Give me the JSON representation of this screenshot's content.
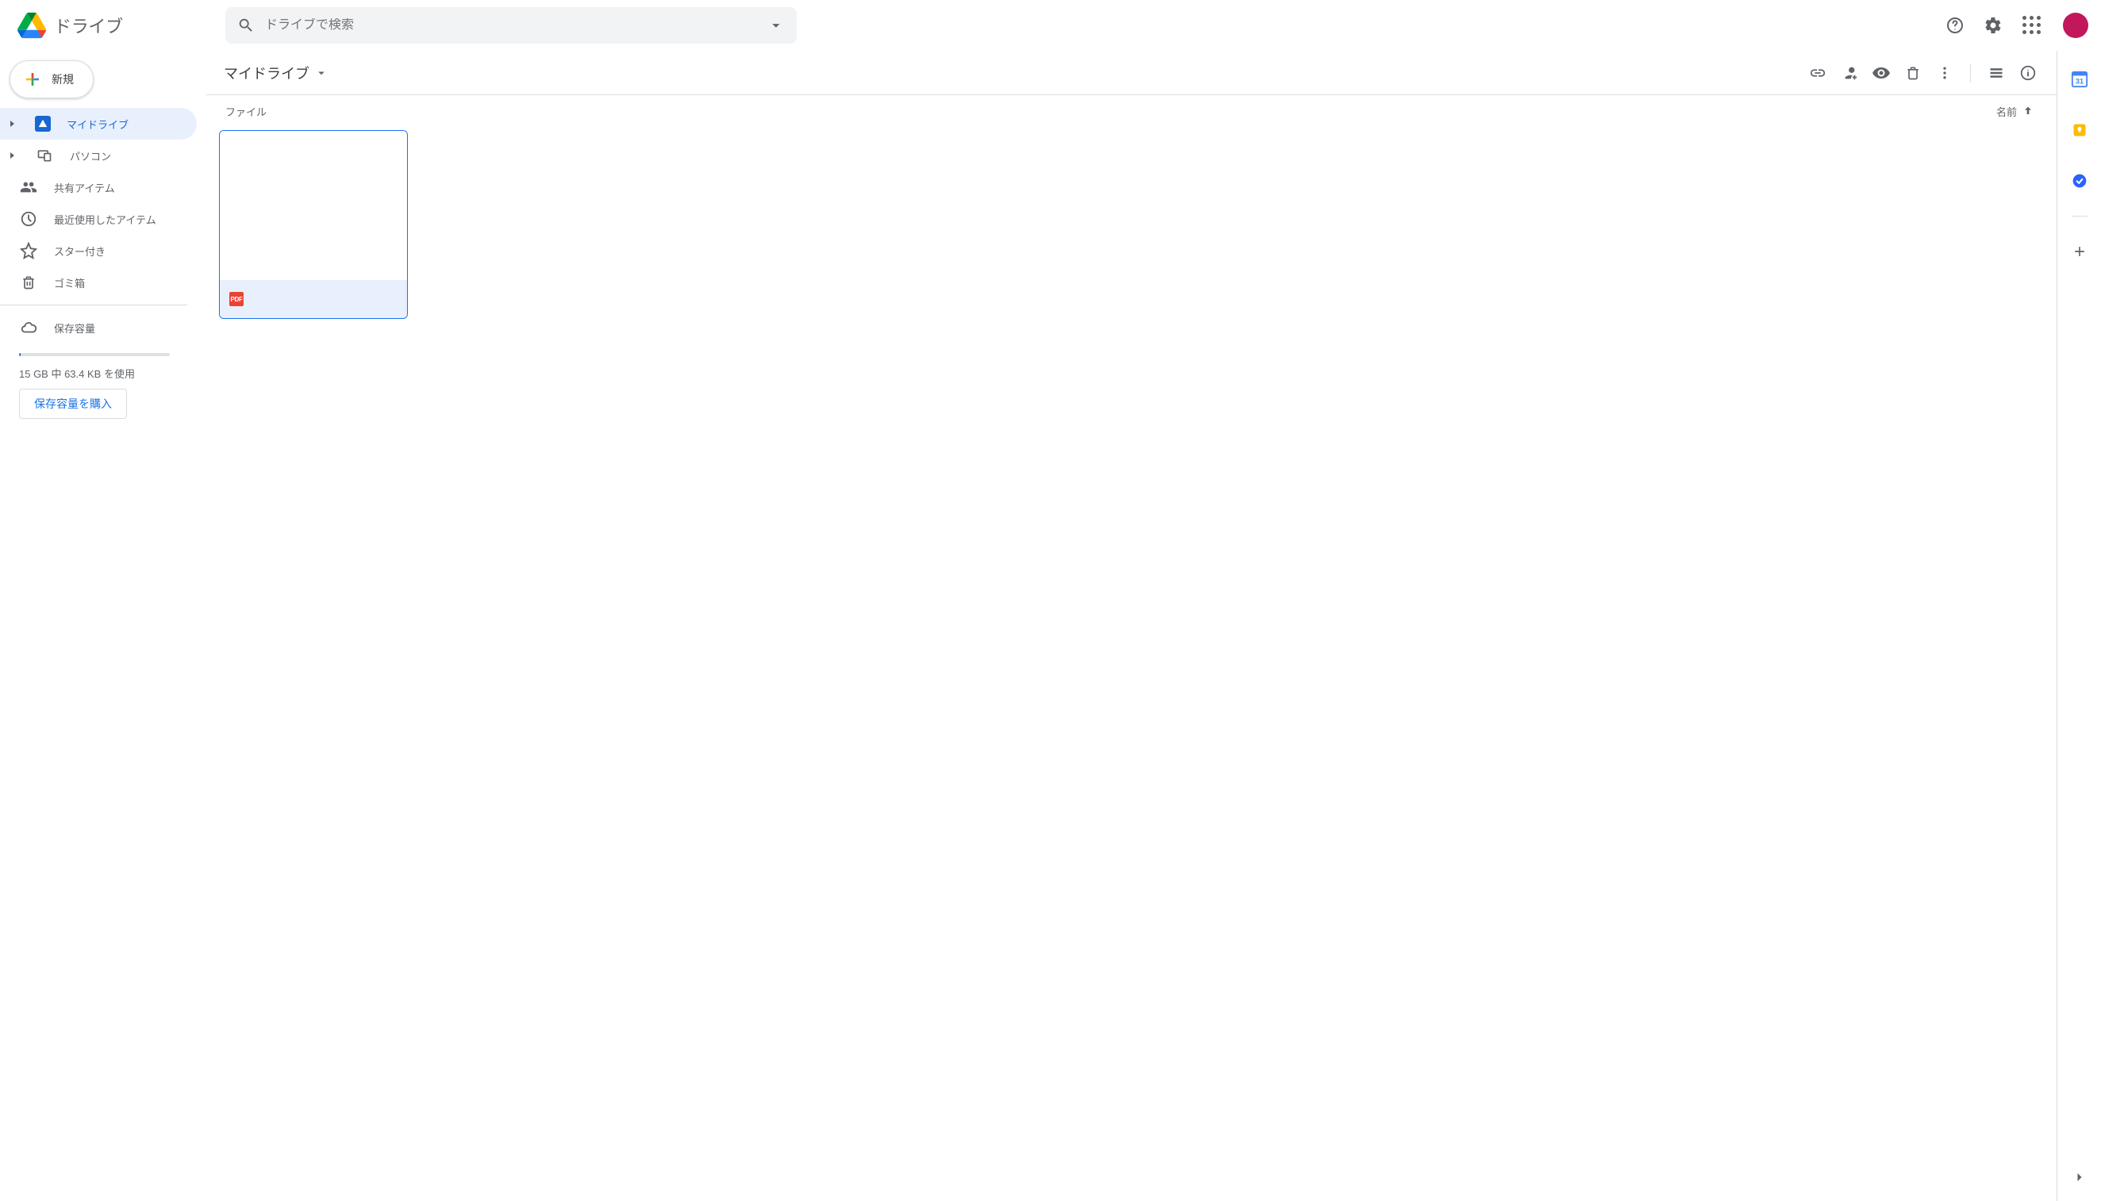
{
  "header": {
    "product_name": "ドライブ",
    "search_placeholder": "ドライブで検索"
  },
  "sidebar": {
    "new_button": "新規",
    "items": [
      {
        "label": "マイドライブ"
      },
      {
        "label": "パソコン"
      },
      {
        "label": "共有アイテム"
      },
      {
        "label": "最近使用したアイテム"
      },
      {
        "label": "スター付き"
      },
      {
        "label": "ゴミ箱"
      }
    ],
    "storage_label": "保存容量",
    "storage_usage": "15 GB 中 63.4 KB を使用",
    "buy_storage": "保存容量を購入"
  },
  "pathbar": {
    "current_folder": "マイドライブ"
  },
  "listing": {
    "section_label": "ファイル",
    "sort_label": "名前",
    "files": [
      {
        "type": "pdf",
        "badge": "PDF"
      }
    ]
  },
  "side_apps": {
    "calendar_day": "31"
  }
}
